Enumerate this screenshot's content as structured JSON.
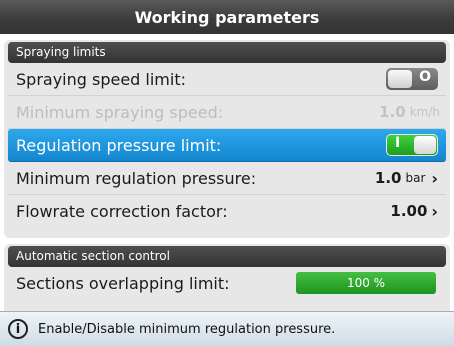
{
  "window": {
    "title": "Working parameters"
  },
  "sections": [
    {
      "header": "Spraying limits",
      "rows": [
        {
          "label": "Spraying speed limit:",
          "toggle_symbol": "O"
        },
        {
          "label": "Minimum spraying speed:",
          "value": "1.0",
          "unit": "km/h"
        },
        {
          "label": "Regulation pressure limit:",
          "toggle_symbol": "I"
        },
        {
          "label": "Minimum regulation pressure:",
          "value": "1.0",
          "unit": "bar",
          "chevron": "›"
        },
        {
          "label": "Flowrate correction factor:",
          "value": "1.00",
          "chevron": "›"
        }
      ]
    },
    {
      "header": "Automatic section control",
      "rows": [
        {
          "label": "Sections overlapping limit:",
          "bar_text": "100 %",
          "level_percent": 100
        }
      ]
    }
  ],
  "info": {
    "icon": "i",
    "text": "Enable/Disable minimum regulation pressure."
  },
  "colors": {
    "selected": "#1e95dc",
    "toggle_on": "#2fb52f",
    "bar": "#2fa82f"
  }
}
